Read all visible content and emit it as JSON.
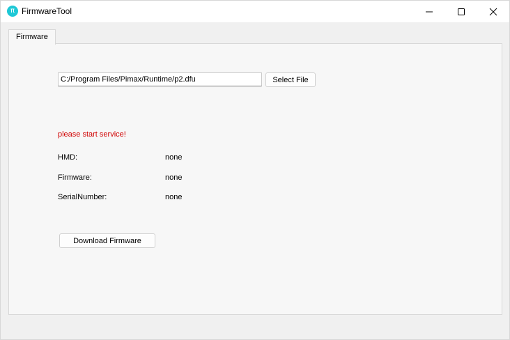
{
  "window": {
    "title": "FirmwareTool",
    "app_icon_glyph": "π",
    "controls": {
      "minimize_icon": "minimize-icon",
      "maximize_icon": "maximize-icon",
      "close_icon": "close-icon"
    }
  },
  "tabs": [
    {
      "label": "Firmware",
      "active": true
    }
  ],
  "file": {
    "path_value": "C:/Program Files/Pimax/Runtime/p2.dfu",
    "select_button_label": "Select File"
  },
  "status": {
    "message": "please start service!",
    "color": "#d00000"
  },
  "info": {
    "hmd_label": "HMD:",
    "hmd_value": "none",
    "firmware_label": "Firmware:",
    "firmware_value": "none",
    "serial_label": "SerialNumber:",
    "serial_value": "none"
  },
  "actions": {
    "download_button_label": "Download Firmware"
  },
  "colors": {
    "accent_icon": "#1ec8d6"
  }
}
